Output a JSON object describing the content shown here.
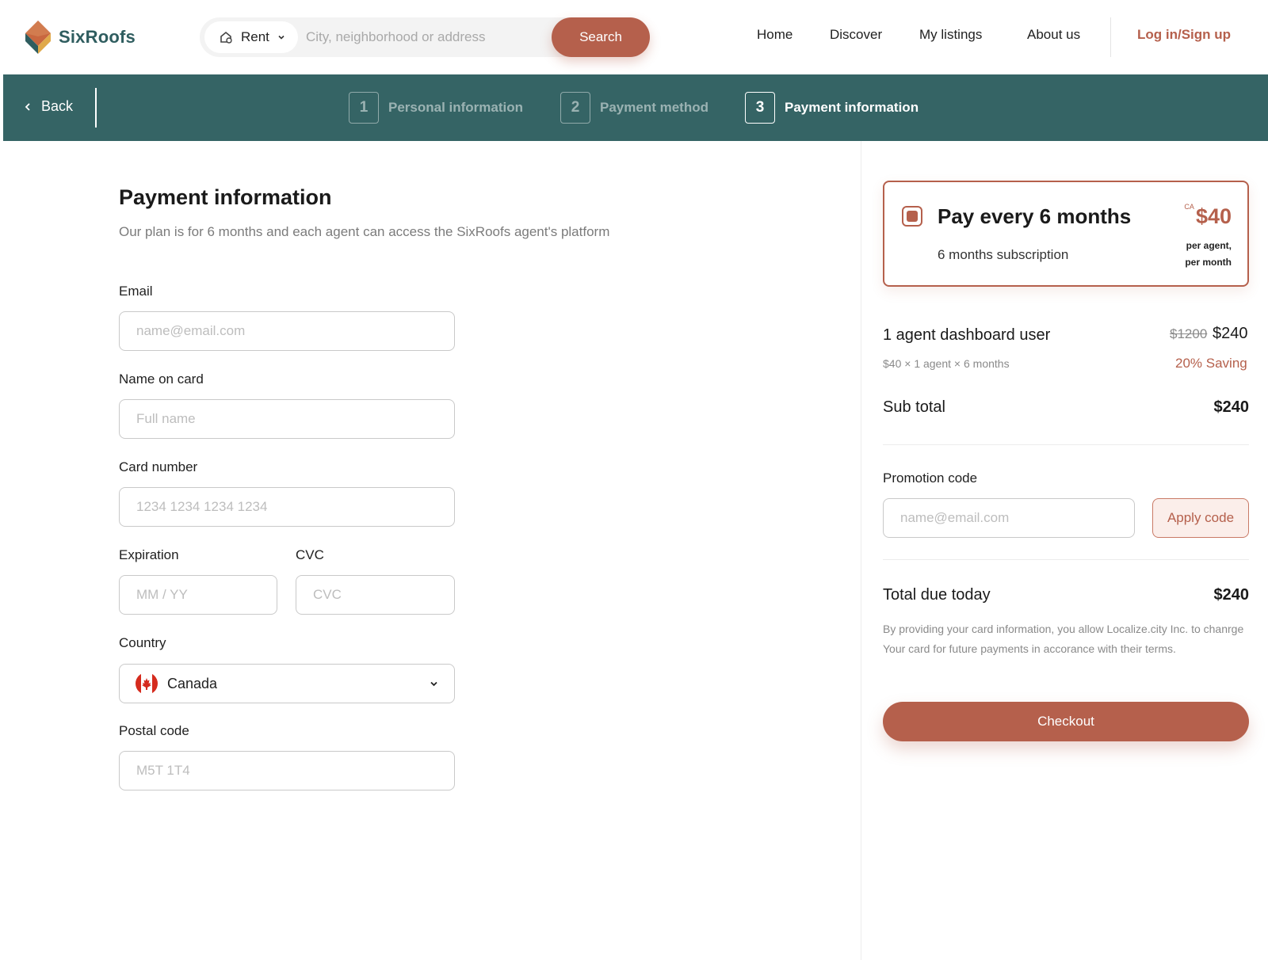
{
  "brand": {
    "name": "SixRoofs",
    "accent": "#b5604c",
    "teal": "#356465"
  },
  "header": {
    "rent_label": "Rent",
    "search_placeholder": "City, neighborhood or address",
    "search_button": "Search",
    "nav": [
      "Home",
      "Discover",
      "My listings",
      "About us"
    ],
    "login": "Log in/Sign up"
  },
  "stepbar": {
    "back": "Back",
    "steps": [
      {
        "num": "1",
        "label": "Personal information",
        "state": "done"
      },
      {
        "num": "2",
        "label": "Payment method",
        "state": "done"
      },
      {
        "num": "3",
        "label": "Payment information",
        "state": "active"
      }
    ]
  },
  "form": {
    "title": "Payment information",
    "subtitle": "Our plan is for 6 months and each agent can access the SixRoofs agent's platform",
    "email_label": "Email",
    "email_placeholder": "name@email.com",
    "name_label": "Name on card",
    "name_placeholder": "Full name",
    "card_label": "Card number",
    "card_placeholder": "1234 1234 1234 1234",
    "exp_label": "Expiration",
    "exp_placeholder": "MM / YY",
    "cvc_label": "CVC",
    "cvc_placeholder": "CVC",
    "country_label": "Country",
    "country_value": "Canada",
    "postal_label": "Postal code",
    "postal_placeholder": "M5T 1T4"
  },
  "summary": {
    "plan_title": "Pay every 6 months",
    "plan_sub": "6 months subscription",
    "plan_currency": "CA",
    "plan_price": "$40",
    "plan_per_1": "per agent,",
    "plan_per_2": "per month",
    "line_label": "1 agent dashboard user",
    "line_detail": "$40 × 1 agent × 6 months",
    "line_old": "$1200",
    "line_new": "$240",
    "line_saving": "20% Saving",
    "subtotal_label": "Sub total",
    "subtotal_value": "$240",
    "promo_label": "Promotion code",
    "promo_placeholder": "name@email.com",
    "promo_button": "Apply code",
    "total_label": "Total due today",
    "total_value": "$240",
    "terms": "By providing your card information, you allow Localize.city Inc. to chanrge Your card for future payments in accorance with their terms.",
    "checkout": "Checkout"
  }
}
